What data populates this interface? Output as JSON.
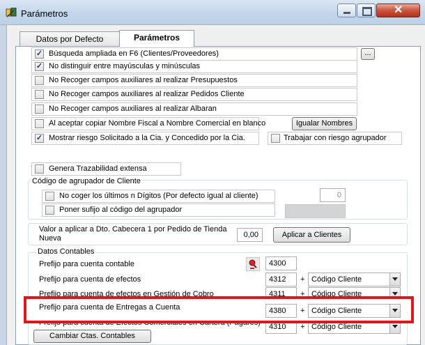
{
  "window": {
    "title": "Parámetros"
  },
  "tabs": [
    {
      "label": "Datos por Defecto",
      "active": false
    },
    {
      "label": "Parámetros",
      "active": true
    }
  ],
  "options": [
    {
      "label": "Búsqueda ampliada en F6 (Clientes/Proveedores)",
      "checked": true
    },
    {
      "label": "No distinguir entre mayúsculas y minúsculas",
      "checked": true
    },
    {
      "label": "No Recoger campos auxiliares al realizar Presupuestos",
      "checked": false
    },
    {
      "label": "No Recoger campos auxiliares al realizar Pedidos Cliente",
      "checked": false
    },
    {
      "label": "No Recoger campos auxiliares al realizar Albaran",
      "checked": false
    },
    {
      "label": "Al aceptar copiar Nombre Fiscal a Nombre Comercial en blanco",
      "checked": false
    },
    {
      "label": "Mostrar riesgo Solicitado a la Cia. y Concedido por la Cia.",
      "checked": true
    }
  ],
  "ellipsis_button": "...",
  "igualar_button": "Igualar Nombres",
  "trabajar_riesgo": {
    "label": "Trabajar con riesgo agrupador",
    "checked": false
  },
  "trazabilidad": {
    "label": "Genera Trazabilidad extensa",
    "checked": false
  },
  "agrupador": {
    "title": "Código de agrupador de Cliente",
    "no_coger": {
      "label": "No coger los últimos n Dígitos (Por defecto igual al cliente)",
      "checked": false,
      "value": "0"
    },
    "sufijo": {
      "label": "Poner sufijo al código del agrupador",
      "checked": false
    }
  },
  "dto": {
    "label": "Valor a aplicar a Dto. Cabecera 1 por Pedido de Tienda Nueva",
    "value": "0,00",
    "button": "Aplicar a Clientes"
  },
  "contables": {
    "title": "Datos Contables",
    "rows": [
      {
        "label": "Prefijo para cuenta contable",
        "value": "4300",
        "combo": ""
      },
      {
        "label": "Prefijo para cuenta de efectos",
        "value": "4312",
        "plus": "+",
        "combo": "Código Cliente"
      },
      {
        "label": "Prefijo para cuenta de efectos en Gestión de Cobro",
        "value": "4311",
        "plus": "+",
        "combo": "Código Cliente"
      },
      {
        "label": "Prefijo para cuenta de Entregas a Cuenta",
        "value": "4380",
        "plus": "+",
        "combo": "Código Cliente"
      },
      {
        "label": "Prefijo para cuenta de Efectos Comerciales en Cartera (Pagarés)",
        "value": "4310",
        "plus": "+",
        "combo": "Código Cliente"
      }
    ],
    "button": "Cambiar Ctas. Contables"
  },
  "colors": {
    "highlight": "#e0161d"
  }
}
